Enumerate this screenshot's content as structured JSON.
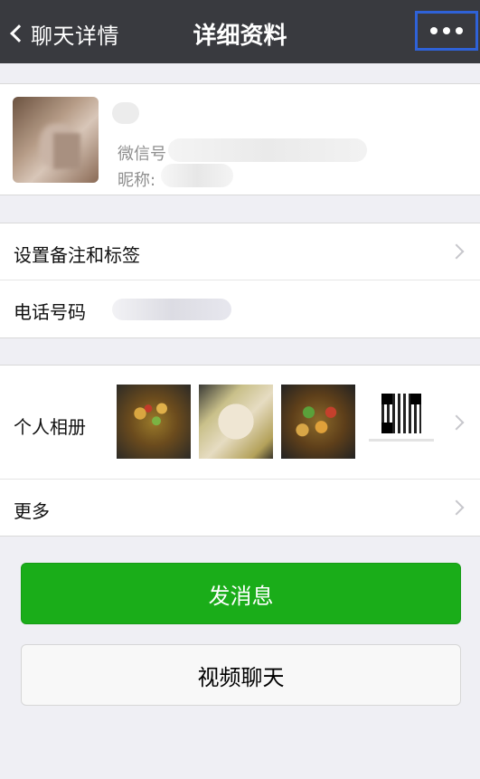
{
  "nav": {
    "back_label": "聊天详情",
    "title": "详细资料",
    "more_icon": "more-dots-icon"
  },
  "profile": {
    "wechat_id_label": "微信号",
    "nickname_label": "昵称:"
  },
  "settings": {
    "remark_tags_label": "设置备注和标签",
    "phone_label": "电话号码"
  },
  "album": {
    "label": "个人相册",
    "photos": [
      "food-photo",
      "food-photo",
      "food-photo",
      "qr-code-image"
    ]
  },
  "more": {
    "label": "更多"
  },
  "actions": {
    "send_message": "发消息",
    "video_chat": "视频聊天"
  },
  "colors": {
    "navbar": "#393a3f",
    "primary_button": "#1aad19",
    "highlight_box": "#2f62d8",
    "background": "#efeff4"
  }
}
